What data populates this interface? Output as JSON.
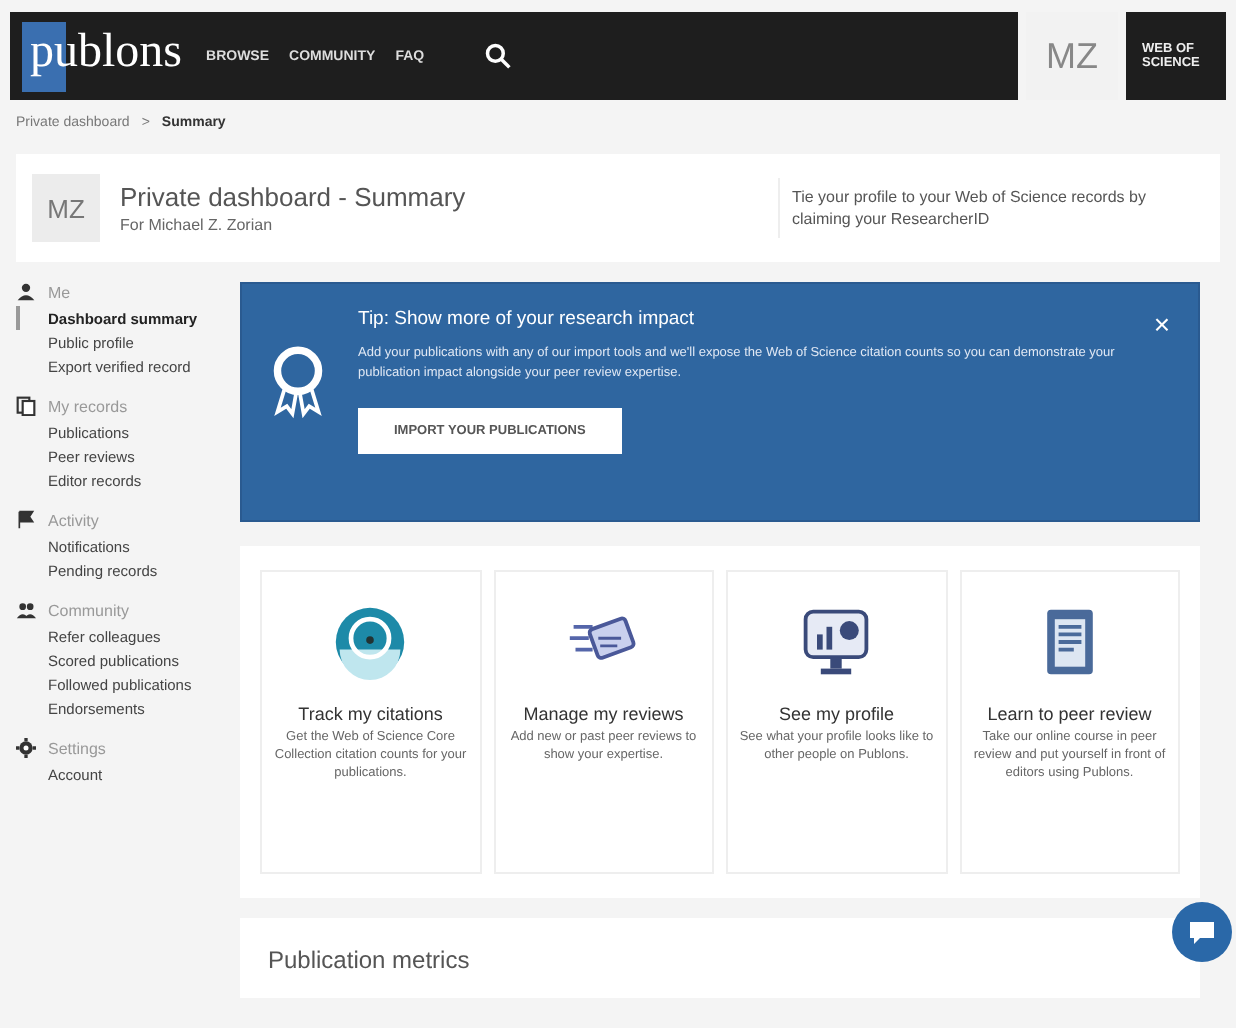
{
  "nav": {
    "logo": "publons",
    "links": [
      "BROWSE",
      "COMMUNITY",
      "FAQ"
    ],
    "avatar": "MZ",
    "wos": "WEB OF SCIENCE"
  },
  "breadcrumb": {
    "items": [
      "Private dashboard",
      "Summary"
    ],
    "separator": ">"
  },
  "header": {
    "avatar": "MZ",
    "title": "Private dashboard - Summary",
    "subtitle": "For Michael Z. Zorian",
    "tip": "Tie your profile to your Web of Science records by claiming your ResearcherID"
  },
  "sidebar": [
    {
      "kind": "person",
      "label": "Me",
      "items": [
        {
          "label": "Dashboard summary",
          "selected": true
        },
        {
          "label": "Public profile",
          "selected": false
        },
        {
          "label": "Export verified record",
          "selected": false
        }
      ]
    },
    {
      "kind": "records",
      "label": "My records",
      "items": [
        {
          "label": "Publications",
          "selected": false
        },
        {
          "label": "Peer reviews",
          "selected": false
        },
        {
          "label": "Editor records",
          "selected": false
        }
      ]
    },
    {
      "kind": "flag",
      "label": "Activity",
      "items": [
        {
          "label": "Notifications",
          "selected": false
        },
        {
          "label": "Pending records",
          "selected": false
        }
      ]
    },
    {
      "kind": "community",
      "label": "Community",
      "items": [
        {
          "label": "Refer colleagues",
          "selected": false
        },
        {
          "label": "Scored publications",
          "selected": false
        },
        {
          "label": "Followed publications",
          "selected": false
        },
        {
          "label": "Endorsements",
          "selected": false
        }
      ]
    },
    {
      "kind": "settings",
      "label": "Settings",
      "items": [
        {
          "label": "Account",
          "selected": false
        }
      ]
    }
  ],
  "tip": {
    "title": "Tip: Show more of your research impact",
    "body": "Add your publications with any of our import tools and we'll expose the Web of Science citation counts so you can demonstrate your publication impact alongside your peer review expertise.",
    "button": "IMPORT YOUR PUBLICATIONS",
    "close": "×"
  },
  "cards": [
    {
      "kind": "gauge",
      "title": "Track my citations",
      "text": "Get the Web of Science Core Collection citation counts for your publications."
    },
    {
      "kind": "review",
      "title": "Manage my reviews",
      "text": "Add new or past peer reviews to show your expertise."
    },
    {
      "kind": "monitor",
      "title": "See my profile",
      "text": "See what your profile looks like to other people on Publons."
    },
    {
      "kind": "document",
      "title": "Learn to peer review",
      "text": "Take our online course in peer review and put yourself in front of editors using Publons."
    }
  ],
  "metrics": {
    "title": "Publication metrics"
  }
}
